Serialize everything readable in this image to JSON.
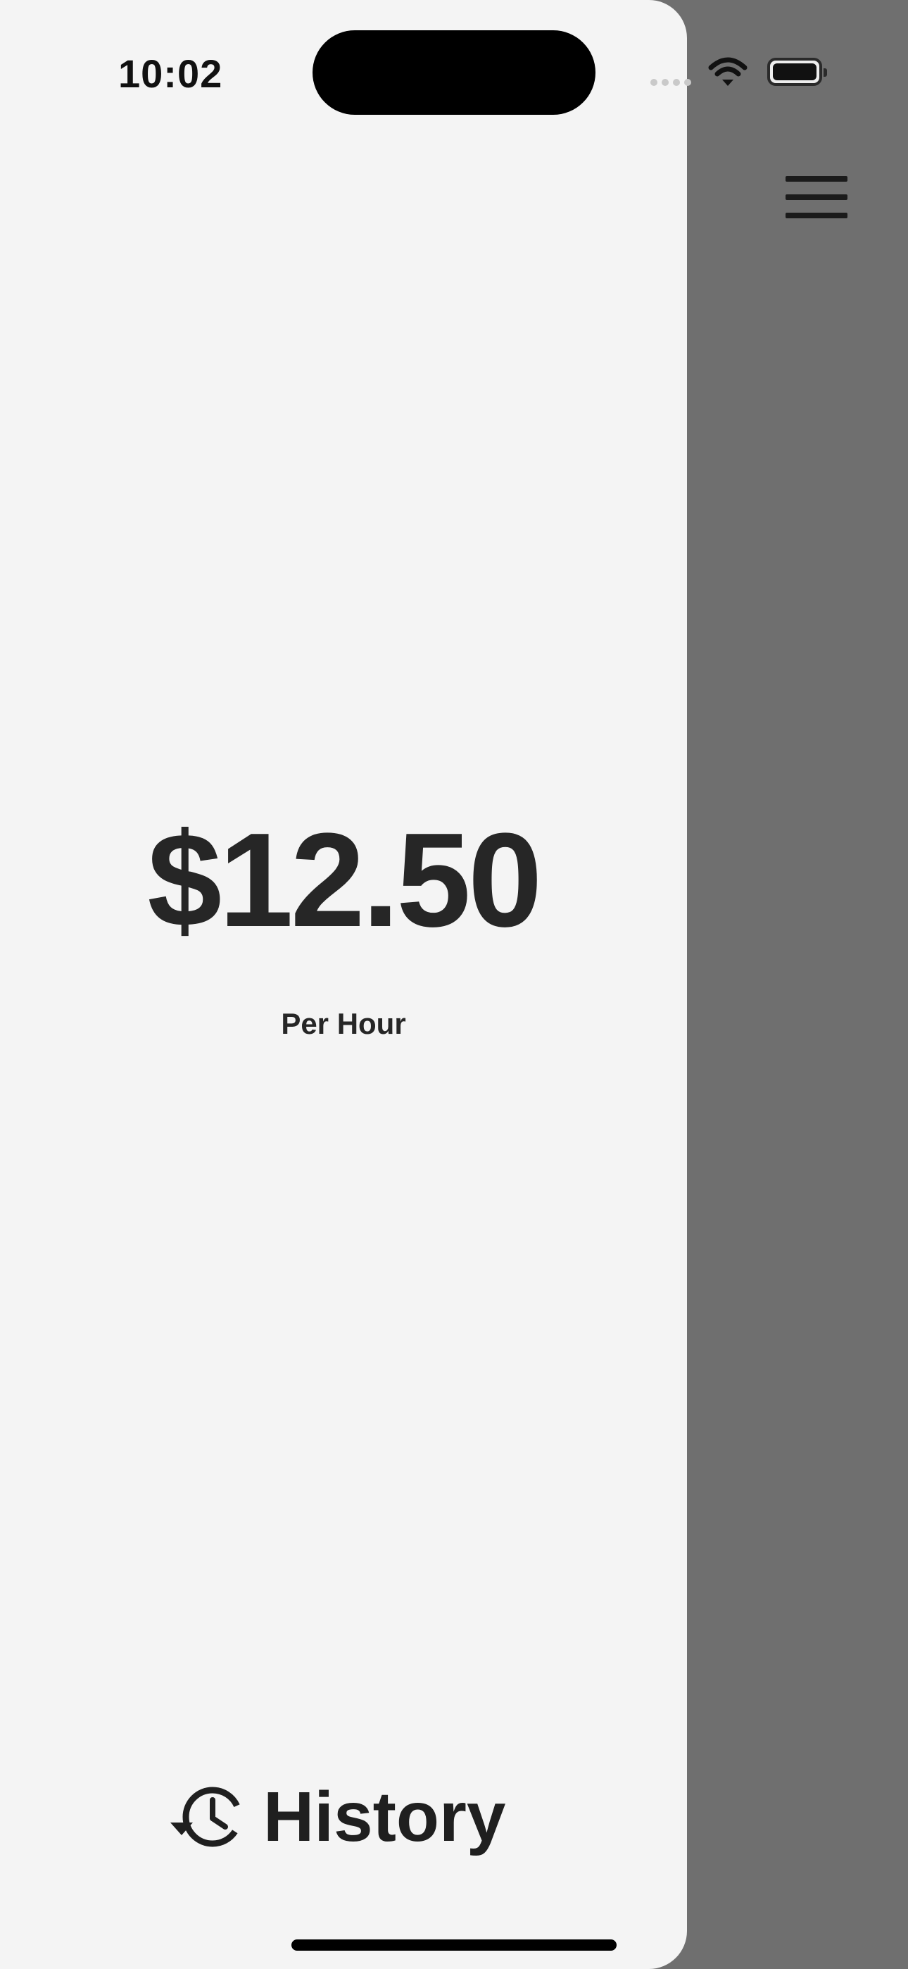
{
  "status_bar": {
    "time": "10:02"
  },
  "icons": {
    "menu": "hamburger-menu-icon",
    "history": "history-icon",
    "wifi": "wifi-icon",
    "battery": "battery-icon"
  },
  "main": {
    "rate": "$12.50",
    "rate_unit": "Per Hour"
  },
  "footer": {
    "history_label": "History"
  },
  "colors": {
    "panel_background": "#f4f4f4",
    "backdrop": "#6f6f6f",
    "text": "#262626"
  }
}
